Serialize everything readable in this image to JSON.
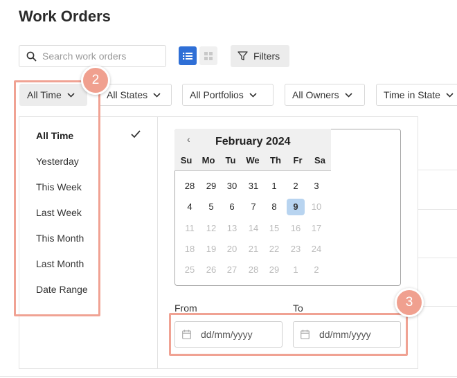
{
  "header": {
    "title": "Work Orders"
  },
  "search": {
    "placeholder": "Search work orders"
  },
  "toolbar": {
    "filters_label": "Filters"
  },
  "dropdowns": {
    "time": "All Time",
    "states": "All States",
    "portfolios": "All Portfolios",
    "owners": "All Owners",
    "time_in_state": "Time in State"
  },
  "time_menu": {
    "items": [
      "All Time",
      "Yesterday",
      "This Week",
      "Last Week",
      "This Month",
      "Last Month",
      "Date Range"
    ],
    "selected": "All Time"
  },
  "calendar": {
    "month_label": "February 2024",
    "prev_symbol": "‹",
    "weekdays": [
      "Su",
      "Mo",
      "Tu",
      "We",
      "Th",
      "Fr",
      "Sa"
    ],
    "weeks": [
      [
        "28",
        "29",
        "30",
        "31",
        "1",
        "2",
        "3"
      ],
      [
        "4",
        "5",
        "6",
        "7",
        "8",
        "9",
        "10"
      ],
      [
        "11",
        "12",
        "13",
        "14",
        "15",
        "16",
        "17"
      ],
      [
        "18",
        "19",
        "20",
        "21",
        "22",
        "23",
        "24"
      ],
      [
        "25",
        "26",
        "27",
        "28",
        "29",
        "1",
        "2"
      ]
    ],
    "selected_day": "9"
  },
  "date_range": {
    "from_label": "From",
    "to_label": "To",
    "from_placeholder": "dd/mm/yyyy",
    "to_placeholder": "dd/mm/yyyy"
  },
  "callouts": {
    "badge_2": "2",
    "badge_3": "3"
  },
  "colors": {
    "accent": "#2f6fd6",
    "highlight": "#f0a293",
    "selected_day": "#b8d4f0",
    "muted_text": "#bbbbbb"
  }
}
